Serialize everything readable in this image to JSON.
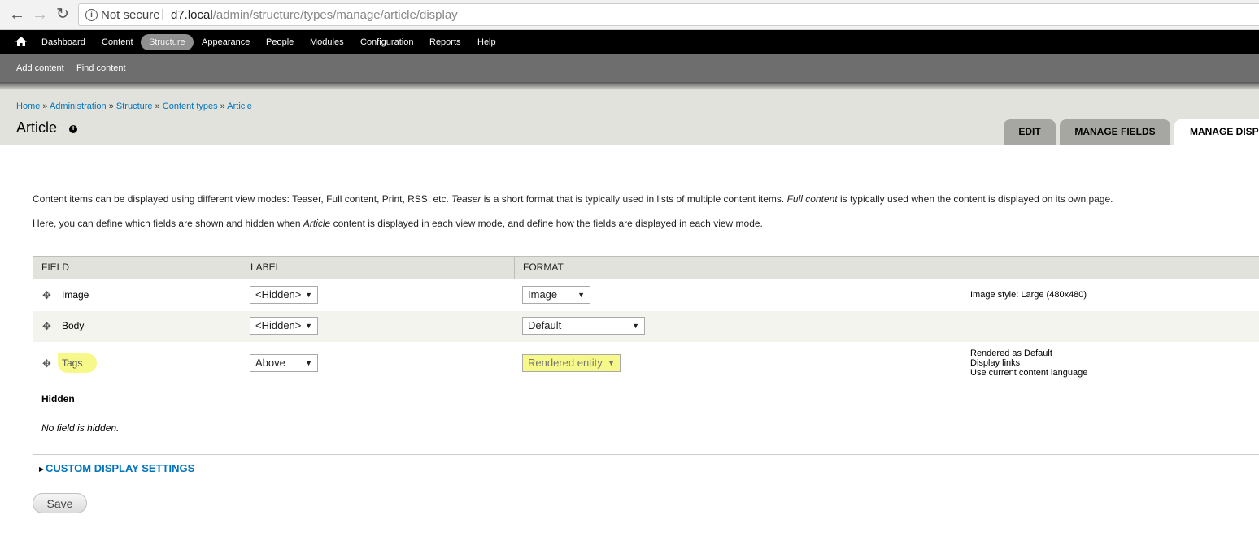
{
  "browser": {
    "security_label": "Not secure",
    "url_host": "d7.local",
    "url_path": "/admin/structure/types/manage/article/display"
  },
  "toolbar": {
    "items": [
      "Dashboard",
      "Content",
      "Structure",
      "Appearance",
      "People",
      "Modules",
      "Configuration",
      "Reports",
      "Help"
    ],
    "active": "Structure"
  },
  "shortcuts": [
    "Add content",
    "Find content"
  ],
  "breadcrumb": [
    "Home",
    "Administration",
    "Structure",
    "Content types",
    "Article"
  ],
  "page_title": "Article",
  "tabs": [
    {
      "label": "EDIT"
    },
    {
      "label": "MANAGE FIELDS"
    },
    {
      "label": "MANAGE DISP",
      "active": true
    }
  ],
  "description": {
    "line1_a": "Content items can be displayed using different view modes: Teaser, Full content, Print, RSS, etc. ",
    "line1_b": "Teaser",
    "line1_c": " is a short format that is typically used in lists of multiple content items. ",
    "line1_d": "Full content",
    "line1_e": " is typically used when the content is displayed on its own page.",
    "line2_a": "Here, you can define which fields are shown and hidden when ",
    "line2_b": "Article",
    "line2_c": " content is displayed in each view mode, and define how the fields are displayed in each view mode."
  },
  "table": {
    "headers": [
      "FIELD",
      "LABEL",
      "FORMAT"
    ],
    "rows": [
      {
        "field": "Image",
        "label": "<Hidden>",
        "format": "Image",
        "summary": [
          "Image style: Large (480x480)"
        ]
      },
      {
        "field": "Body",
        "label": "<Hidden>",
        "format": "Default",
        "summary": []
      },
      {
        "field": "Tags",
        "label": "Above",
        "format": "Rendered entity",
        "summary": [
          "Rendered as Default",
          "Display links",
          "Use current content language"
        ]
      }
    ],
    "hidden_title": "Hidden",
    "no_hidden": "No field is hidden."
  },
  "custom_settings_label": "CUSTOM DISPLAY SETTINGS",
  "save_label": "Save",
  "colors": {
    "link": "#0074bd",
    "highlight": "#f6f88a",
    "toolbar": "#000000",
    "shortcut_bar": "#6e6e6e"
  }
}
